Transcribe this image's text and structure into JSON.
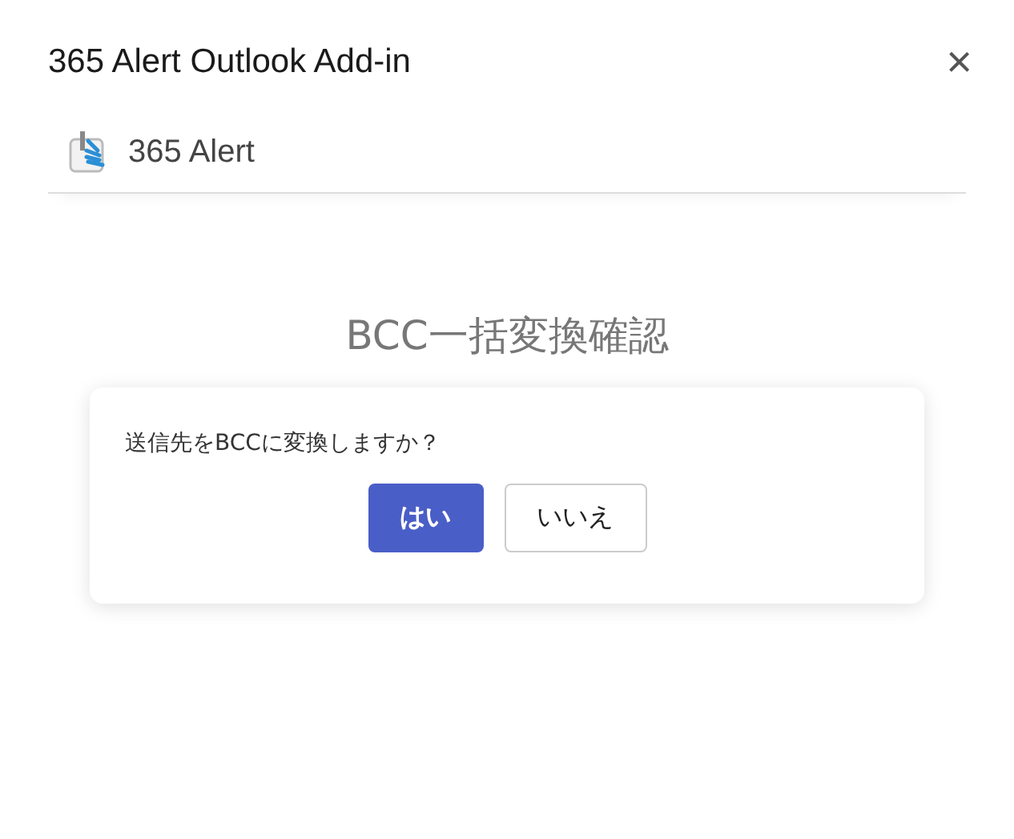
{
  "window": {
    "title": "365 Alert Outlook Add-in",
    "close": "×"
  },
  "header": {
    "app_name": "365 Alert"
  },
  "dialog": {
    "heading": "BCC一括変換確認",
    "message": "送信先をBCCに変換しますか？",
    "buttons": [
      {
        "label": "はい",
        "kind": "primary"
      },
      {
        "label": "いいえ",
        "kind": "secondary"
      }
    ]
  }
}
